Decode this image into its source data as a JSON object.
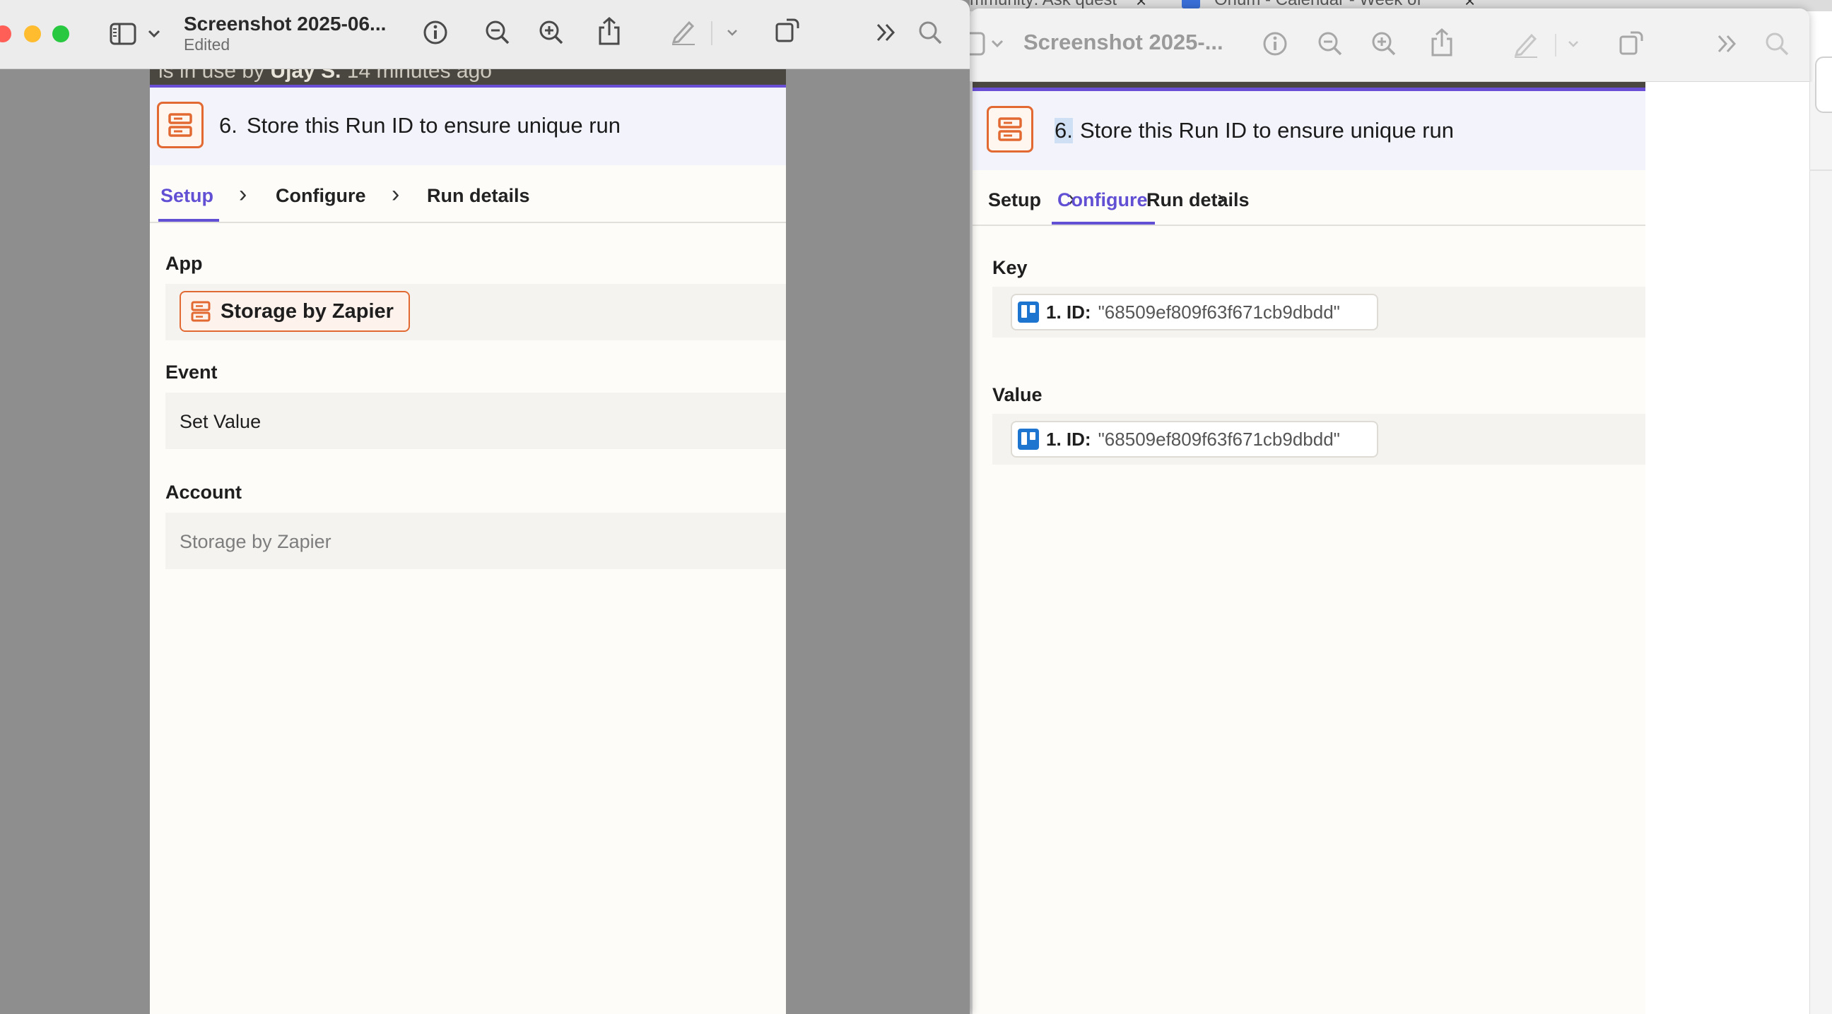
{
  "left_window": {
    "title": "Screenshot 2025-06...",
    "subtitle": "Edited",
    "icons": [
      "sidebar-icon",
      "chevron-down-icon",
      "info-icon",
      "zoom-out-icon",
      "zoom-in-icon",
      "share-icon",
      "markup-pen-icon",
      "chevron-down-icon",
      "rotate-icon",
      "more-icon",
      "search-icon"
    ]
  },
  "right_window": {
    "title": "Screenshot 2025-...",
    "browser_tab_1": "mmunity: Ask quest",
    "browser_tab_2": "Orium - Calendar - Week of",
    "browser_tab_close": "×"
  },
  "left_panel": {
    "banner_prefix": "is in use by",
    "banner_user": "Ujay S.",
    "banner_suffix": "14 minutes ago",
    "step_number": "6.",
    "step_title": "Store this Run ID to ensure unique run",
    "tabs": [
      {
        "label": "Setup",
        "active": true
      },
      {
        "label": "Configure",
        "active": false
      },
      {
        "label": "Run details",
        "active": false
      }
    ],
    "app_label": "App",
    "app_value": "Storage by Zapier",
    "event_label": "Event",
    "event_value": "Set Value",
    "account_label": "Account",
    "account_placeholder": "Storage by Zapier"
  },
  "right_panel": {
    "step_number": "6.",
    "step_title": "Store this Run ID to ensure unique run",
    "tabs": [
      {
        "label": "Setup",
        "active": false
      },
      {
        "label": "Configure",
        "active": true
      },
      {
        "label": "Run details",
        "active": false
      }
    ],
    "key_label": "Key",
    "key_id_label": "1. ID:",
    "key_id_value": "\"68509ef809f63f671cb9dbdd\"",
    "value_label": "Value",
    "value_id_label": "1. ID:",
    "value_id_value": "\"68509ef809f63f671cb9dbdd\""
  },
  "colors": {
    "accent": "#6250d4",
    "storage_orange": "#e26a32",
    "trello_blue": "#1e75cf",
    "traffic_close": "#ff5f57",
    "traffic_min": "#febc2e",
    "traffic_max": "#28c840"
  }
}
